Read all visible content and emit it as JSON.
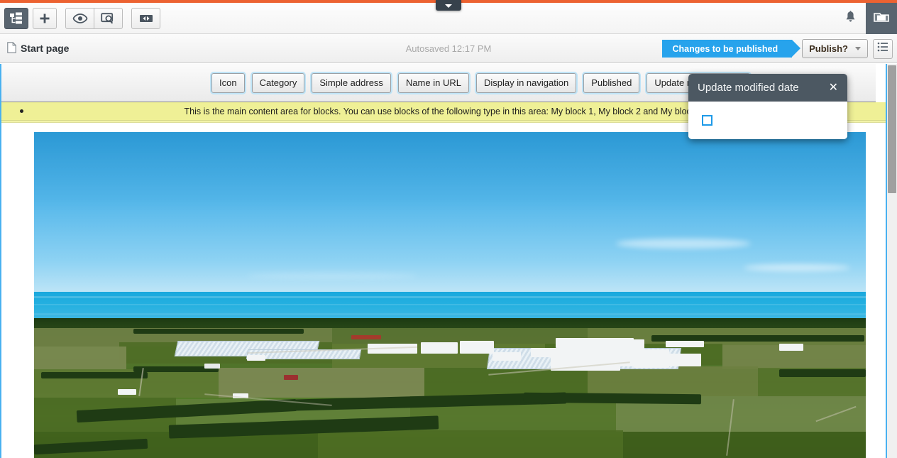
{
  "window": {
    "accent_color": "#ec6231",
    "frame_color": "#49b1f0"
  },
  "global_toolbar": {
    "buttons": [
      {
        "name": "navigation-tree-toggle",
        "icon": "tree-icon",
        "active": true
      },
      {
        "name": "add-content",
        "icon": "plus-icon",
        "active": false
      },
      {
        "name": "toggle-preview",
        "icon": "eye-icon",
        "active": false
      },
      {
        "name": "inspect-mode",
        "icon": "inspect-icon",
        "active": false
      },
      {
        "name": "resize-view",
        "icon": "resize-horizontal-icon",
        "active": false
      }
    ],
    "notifications_icon": "bell-icon",
    "assets_icon": "folder-icon"
  },
  "page_header": {
    "page_icon": "document-icon",
    "title": "Start page",
    "autosave_status": "Autosaved 12:17 PM",
    "publish_status_label": "Changes to be published",
    "publish_status_color": "#27a3ec",
    "publish_button_label": "Publish?",
    "publish_chevron_icon": "chevron-down-icon",
    "panel_toggle_icon": "list-panel-icon"
  },
  "property_bar": {
    "buttons": [
      {
        "label": "Icon",
        "name": "property-button-icon"
      },
      {
        "label": "Category",
        "name": "property-button-category"
      },
      {
        "label": "Simple address",
        "name": "property-button-simple-address"
      },
      {
        "label": "Name in URL",
        "name": "property-button-name-in-url"
      },
      {
        "label": "Display in navigation",
        "name": "property-button-display-in-navigation"
      },
      {
        "label": "Published",
        "name": "property-button-published"
      },
      {
        "label": "Update modified date",
        "name": "property-button-update-modified-date"
      }
    ]
  },
  "content_hint": {
    "text": "This is the main content area for blocks. You can use blocks of the following type in this area: My block 1, My block 2 and My block 3",
    "background_color": "#eff096"
  },
  "popup": {
    "title": "Update modified date",
    "close_icon": "close-icon",
    "checkbox_checked": false,
    "checkbox_color": "#1e9ae8"
  },
  "preview": {
    "hero_image_alt": "Aerial photo of coastal farmland with greenhouses and an industrial facility"
  },
  "scrollbar": {
    "name": "vertical-scrollbar"
  }
}
